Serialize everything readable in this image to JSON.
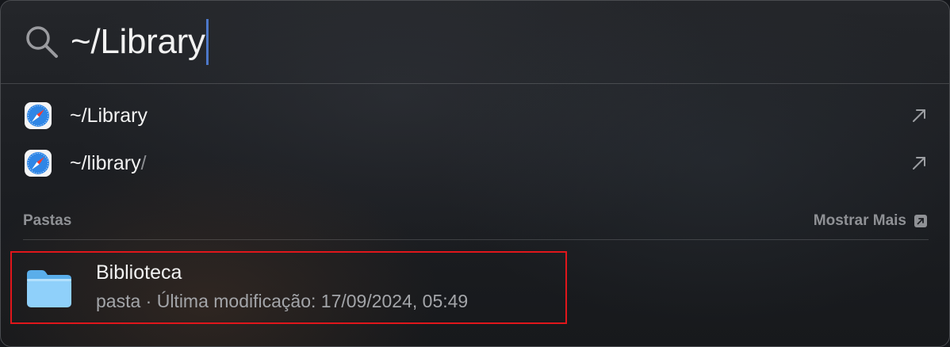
{
  "search": {
    "query": "~/Library"
  },
  "suggestions": [
    {
      "prefix": "~/Library",
      "suffix": "",
      "icon": "safari-icon",
      "action_icon": "open-arrow-icon"
    },
    {
      "prefix": "~/library",
      "suffix": "/",
      "icon": "safari-icon",
      "action_icon": "open-arrow-icon"
    }
  ],
  "section": {
    "title": "Pastas",
    "show_more_label": "Mostrar Mais"
  },
  "result": {
    "title": "Biblioteca",
    "subtitle": "pasta · Última modificação: 17/09/2024, 05:49",
    "icon": "folder-icon"
  },
  "colors": {
    "caret": "#4d78c9",
    "highlight_border": "#e0161b",
    "folder_light": "#8fd0fa",
    "folder_dark": "#5aaeea"
  }
}
